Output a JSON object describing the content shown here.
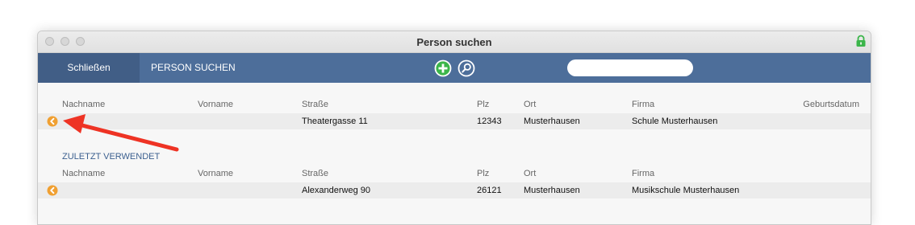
{
  "window": {
    "title": "Person suchen"
  },
  "toolbar": {
    "close_label": "Schließen",
    "title": "PERSON SUCHEN",
    "search_placeholder": "",
    "search_value": ""
  },
  "columns": [
    "Nachname",
    "Vorname",
    "Straße",
    "Plz",
    "Ort",
    "Firma",
    "Geburtsdatum"
  ],
  "recent_columns": [
    "Nachname",
    "Vorname",
    "Straße",
    "Plz",
    "Ort",
    "Firma"
  ],
  "results": [
    {
      "nachname": "",
      "vorname": "",
      "strasse": "Theatergasse 11",
      "plz": "12343",
      "ort": "Musterhausen",
      "firma": "Schule Musterhausen",
      "geburtsdatum": ""
    }
  ],
  "recent": {
    "label": "ZULETZT VERWENDET",
    "rows": [
      {
        "nachname": "",
        "vorname": "",
        "strasse": "Alexanderweg 90",
        "plz": "26121",
        "ort": "Musterhausen",
        "firma": "Musikschule Musterhausen"
      }
    ]
  },
  "colors": {
    "toolbar": "#4d6e9a",
    "close_button": "#415e86",
    "accent_orange": "#f0a032",
    "add_green": "#3bb54a",
    "annotation_arrow": "#ee3324",
    "section_label": "#3b5f8f"
  },
  "icons": {
    "add": "plus-circle-icon",
    "search": "magnifier-icon",
    "row_action": "arrow-left-circle-icon",
    "lock": "lock-icon"
  }
}
